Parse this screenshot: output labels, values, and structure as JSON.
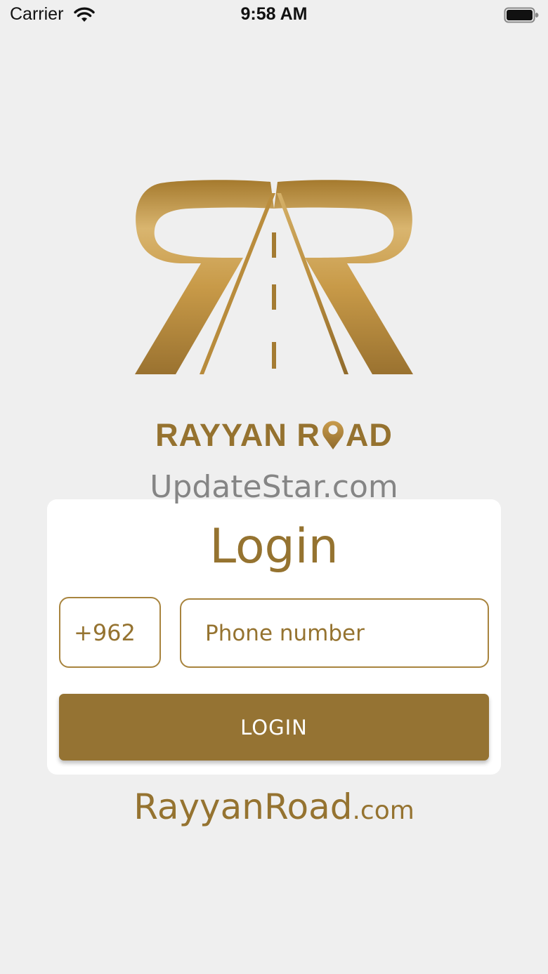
{
  "status_bar": {
    "carrier": "Carrier",
    "time": "9:58 AM"
  },
  "brand": {
    "name_before_pin": "RAYYAN R",
    "name_after_pin": "AD",
    "color": "#95722f"
  },
  "watermark": "UpdateStar.com",
  "login": {
    "title": "Login",
    "country_code": "+962",
    "phone_placeholder": "Phone number",
    "phone_value": "",
    "button_label": "LOGIN"
  },
  "website": {
    "main": "RayyanRoad",
    "tld": ".com"
  },
  "colors": {
    "background": "#efefef",
    "accent": "#957333",
    "card": "#ffffff"
  },
  "icons": {
    "wifi": "wifi-icon",
    "battery": "battery-icon",
    "logo": "rr-road-logo",
    "pin": "location-pin-icon"
  }
}
